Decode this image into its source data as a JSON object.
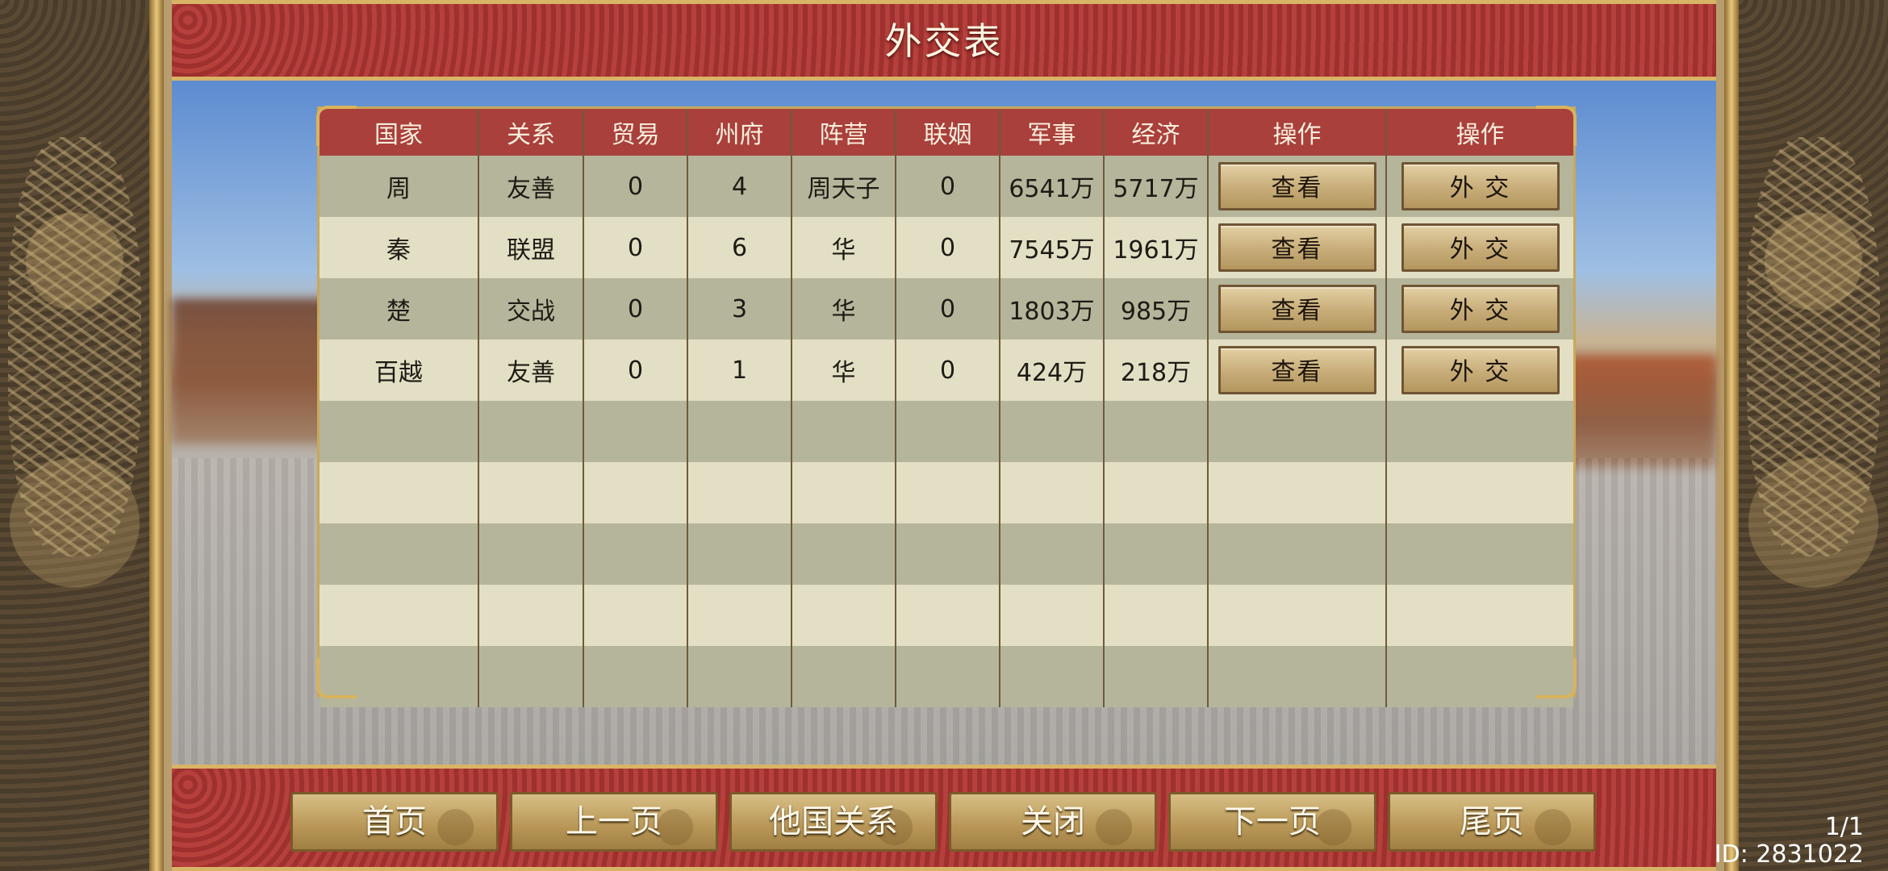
{
  "title": "外交表",
  "table": {
    "headers": [
      "国家",
      "关系",
      "贸易",
      "州府",
      "阵营",
      "联姻",
      "军事",
      "经济",
      "操作",
      "操作"
    ],
    "rows": [
      {
        "country": "周",
        "relation": "友善",
        "trade": "0",
        "prefectures": "4",
        "faction": "周天子",
        "marriage": "0",
        "military": "6541万",
        "economy": "5717万",
        "view": "查看",
        "diplomacy": "外 交"
      },
      {
        "country": "秦",
        "relation": "联盟",
        "trade": "0",
        "prefectures": "6",
        "faction": "华",
        "marriage": "0",
        "military": "7545万",
        "economy": "1961万",
        "view": "查看",
        "diplomacy": "外 交"
      },
      {
        "country": "楚",
        "relation": "交战",
        "trade": "0",
        "prefectures": "3",
        "faction": "华",
        "marriage": "0",
        "military": "1803万",
        "economy": "985万",
        "view": "查看",
        "diplomacy": "外 交"
      },
      {
        "country": "百越",
        "relation": "友善",
        "trade": "0",
        "prefectures": "1",
        "faction": "华",
        "marriage": "0",
        "military": "424万",
        "economy": "218万",
        "view": "查看",
        "diplomacy": "外 交"
      }
    ],
    "empty_rows": 5
  },
  "footer": {
    "buttons": [
      "首页",
      "上一页",
      "他国关系",
      "关闭",
      "下一页",
      "尾页"
    ],
    "page": "1/1",
    "id": "ID: 2831022"
  }
}
